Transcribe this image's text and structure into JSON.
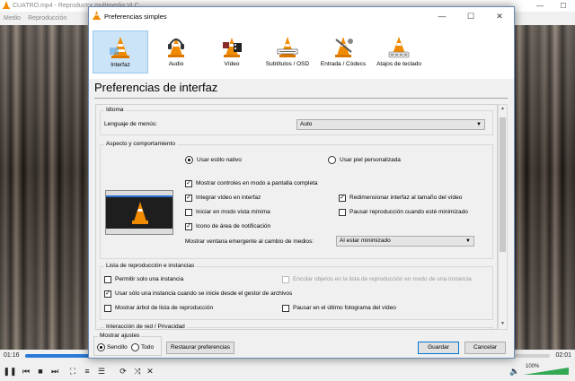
{
  "vlc": {
    "title": "CUATRO.mp4 - Reproductor multimedia VLC",
    "menu": [
      "Medio",
      "Reproducción"
    ],
    "time_elapsed": "01:16",
    "time_total": "02:01",
    "progress": 0.49,
    "volume": "100%"
  },
  "dialog": {
    "title": "Preferencias simples",
    "categories": [
      {
        "label": "Interfaz"
      },
      {
        "label": "Audio"
      },
      {
        "label": "Vídeo"
      },
      {
        "label": "Subtítulos / OSD"
      },
      {
        "label": "Entrada / Códecs"
      },
      {
        "label": "Atajos de teclado"
      }
    ],
    "section_title": "Preferencias de interfaz",
    "idioma": {
      "group": "Idioma",
      "label": "Lenguaje de menús:",
      "value": "Auto"
    },
    "aspecto": {
      "group": "Aspecto y comportamiento",
      "radio_native": "Usar estilo nativo",
      "radio_custom": "Usar piel personalizada",
      "fullscreen_controls": "Mostrar controles en modo a pantalla completa",
      "integrate_video": "Integrar vídeo en interfaz",
      "resize_interface": "Redimensionar interfaz al tamaño del vídeo",
      "minimal_view": "Iniciar en modo vista mínima",
      "pause_minimized": "Pausar reproducción cuando esté minimizado",
      "systray_icon": "Icono de área de notificación",
      "popup_label": "Mostrar ventana emergente al cambio de medios:",
      "popup_value": "Al estar minimizado"
    },
    "playlist": {
      "group": "Lista de reproducción e instancias",
      "one_instance": "Permitir solo una instancia",
      "enqueue": "Encolar objetos en la lista de reproducción en modo de una instancia",
      "file_manager_instance": "Usar sólo una instancia cuando se inicie desde el gestor de archivos",
      "show_tree": "Mostrar árbol de lista de reproducción",
      "pause_last_frame": "Pausar en el último fotograma del vídeo"
    },
    "network": {
      "group": "Interacción de red / Privacidad"
    },
    "footer": {
      "show_settings": "Mostrar ajustes",
      "simple": "Sencillo",
      "all": "Todo",
      "reset": "Restaurar preferencias",
      "save": "Guardar",
      "cancel": "Cancelar"
    }
  },
  "colors": {
    "accent": "#0078d7",
    "selected_tab": "#cce4f7",
    "progress": "#2a7ad8",
    "volume": "#32a852"
  }
}
